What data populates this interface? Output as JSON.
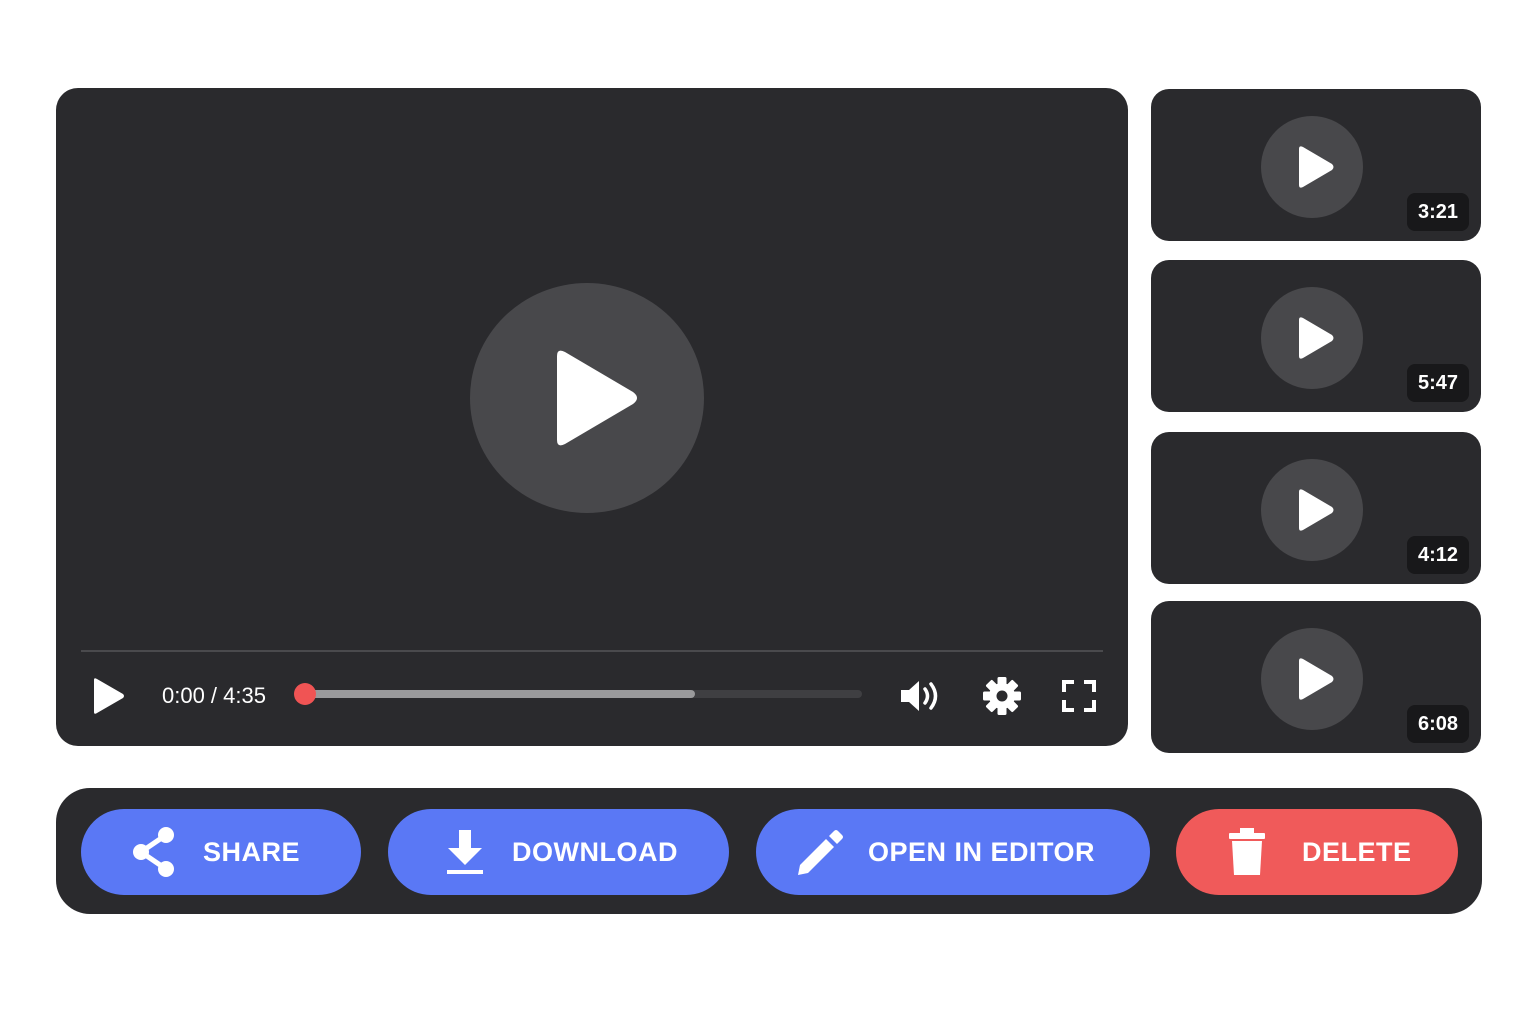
{
  "player": {
    "time_display": "0:00 / 4:35",
    "progress_fraction": 0.7,
    "playhead_fraction": 0.0
  },
  "playlist": [
    {
      "duration": "3:21"
    },
    {
      "duration": "5:47"
    },
    {
      "duration": "4:12"
    },
    {
      "duration": "6:08"
    }
  ],
  "actions": {
    "share_label": "SHARE",
    "download_label": "DOWNLOAD",
    "edit_label": "OPEN IN EDITOR",
    "delete_label": "DELETE"
  },
  "colors": {
    "primary": "#5a78f5",
    "danger": "#f05a5a",
    "surface": "#2a2a2d",
    "playhead": "#f05454"
  },
  "icons": {
    "share": "share-icon",
    "download": "download-icon",
    "edit": "pencil-icon",
    "delete": "trash-icon",
    "volume": "volume-icon",
    "settings": "gear-icon",
    "fullscreen": "fullscreen-icon"
  }
}
